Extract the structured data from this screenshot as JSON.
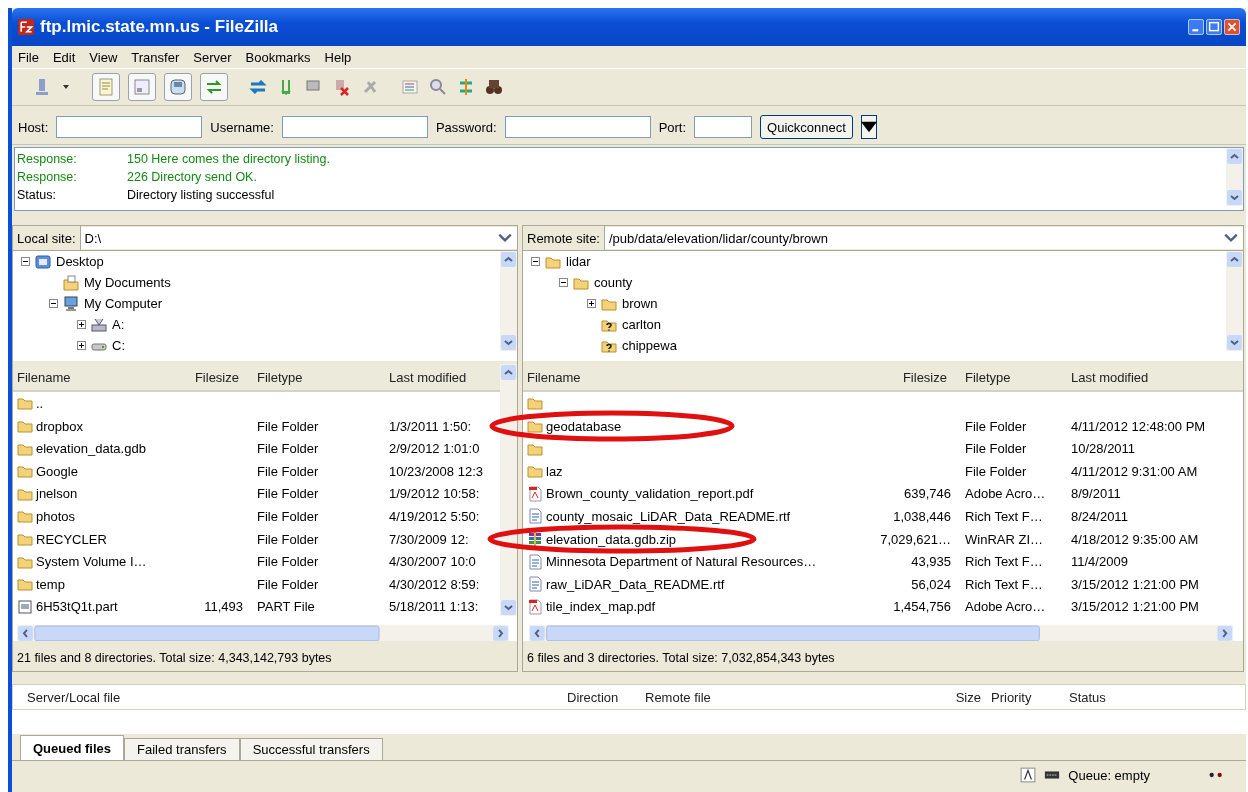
{
  "window": {
    "title": "ftp.lmic.state.mn.us - FileZilla"
  },
  "menu": [
    "File",
    "Edit",
    "View",
    "Transfer",
    "Server",
    "Bookmarks",
    "Help"
  ],
  "quickconnect": {
    "fields": [
      {
        "label": "Host:",
        "kind": "text"
      },
      {
        "label": "Username:",
        "kind": "text"
      },
      {
        "label": "Password:",
        "kind": "password"
      },
      {
        "label": "Port:",
        "kind": "port"
      }
    ],
    "button": "Quickconnect"
  },
  "log": [
    {
      "kind": "response",
      "label": "Response:",
      "message": "150 Here comes the directory listing."
    },
    {
      "kind": "response",
      "label": "Response:",
      "message": "226 Directory send OK."
    },
    {
      "kind": "status",
      "label": "Status:",
      "message": "Directory listing successful"
    }
  ],
  "local": {
    "site_label": "Local site:",
    "path": "D:\\",
    "tree": [
      {
        "name": "Desktop",
        "kind": "desktop",
        "expanded": true,
        "children": [
          {
            "name": "My Documents",
            "kind": "documents"
          },
          {
            "name": "My Computer",
            "kind": "computer",
            "expanded": true,
            "children": [
              {
                "name": "A:",
                "kind": "floppy",
                "expanded": false
              },
              {
                "name": "C:",
                "kind": "drive",
                "expanded": false
              }
            ]
          }
        ]
      }
    ],
    "columns": [
      "Filename",
      "Filesize",
      "Filetype",
      "Last modified"
    ],
    "rows": [
      {
        "kind": "folder",
        "name": ".."
      },
      {
        "kind": "folder",
        "name": "dropbox",
        "type": "File Folder",
        "modified": "1/3/2011 1:50:"
      },
      {
        "kind": "folder",
        "name": "elevation_data.gdb",
        "type": "File Folder",
        "modified": "2/9/2012 1:01:0"
      },
      {
        "kind": "folder",
        "name": "Google",
        "type": "File Folder",
        "modified": "10/23/2008 12:3"
      },
      {
        "kind": "folder",
        "name": "jnelson",
        "type": "File Folder",
        "modified": "1/9/2012 10:58:"
      },
      {
        "kind": "folder",
        "name": "photos",
        "type": "File Folder",
        "modified": "4/19/2012 5:50:"
      },
      {
        "kind": "folder",
        "name": "RECYCLER",
        "type": "File Folder",
        "modified": "7/30/2009 12:"
      },
      {
        "kind": "folder",
        "name": "System Volume I…",
        "type": "File Folder",
        "modified": "4/30/2007 10:0"
      },
      {
        "kind": "folder",
        "name": "temp",
        "type": "File Folder",
        "modified": "4/30/2012 8:59:"
      },
      {
        "kind": "part",
        "name": "6H53tQ1t.part",
        "size": "11,493",
        "type": "PART File",
        "modified": "5/18/2011 1:13:"
      }
    ],
    "summary": "21 files and 8 directories. Total size: 4,343,142,793 bytes"
  },
  "remote": {
    "site_label": "Remote site:",
    "path": "/pub/data/elevation/lidar/county/brown",
    "tree": [
      {
        "name": "lidar",
        "kind": "folder",
        "expanded": true,
        "children": [
          {
            "name": "county",
            "kind": "folder",
            "expanded": true,
            "children": [
              {
                "name": "brown",
                "kind": "folder",
                "expanded": false
              },
              {
                "name": "carlton",
                "kind": "unknown"
              },
              {
                "name": "chippewa",
                "kind": "unknown"
              }
            ]
          }
        ]
      }
    ],
    "columns": [
      "Filename",
      "Filesize",
      "Filetype",
      "Last modified"
    ],
    "rows": [
      {
        "kind": "folder"
      },
      {
        "kind": "folder",
        "name": "geodatabase",
        "type": "File Folder",
        "modified": "4/11/2012 12:48:00 PM"
      },
      {
        "kind": "folder",
        "type": "File Folder",
        "modified": "10/28/2011"
      },
      {
        "kind": "folder",
        "name": "laz",
        "type": "File Folder",
        "modified": "4/11/2012 9:31:00 AM"
      },
      {
        "kind": "pdf",
        "name": "Brown_county_validation_report.pdf",
        "size": "639,746",
        "type": "Adobe Acro…",
        "modified": "8/9/2011"
      },
      {
        "kind": "rtf",
        "name": "county_mosaic_LiDAR_Data_README.rtf",
        "size": "1,038,446",
        "type": "Rich Text F…",
        "modified": "8/24/2011"
      },
      {
        "kind": "zip",
        "name": "elevation_data.gdb.zip",
        "size": "7,029,621…",
        "type": "WinRAR ZI…",
        "modified": "4/18/2012 9:35:00 AM"
      },
      {
        "kind": "rtf",
        "name": "Minnesota Department of Natural Resources…",
        "size": "43,935",
        "type": "Rich Text F…",
        "modified": "11/4/2009"
      },
      {
        "kind": "rtf",
        "name": "raw_LiDAR_Data_README.rtf",
        "size": "56,024",
        "type": "Rich Text F…",
        "modified": "3/15/2012 1:21:00 PM"
      },
      {
        "kind": "pdf",
        "name": "tile_index_map.pdf",
        "size": "1,454,756",
        "type": "Adobe Acro…",
        "modified": "3/15/2012 1:21:00 PM"
      }
    ],
    "summary": "6 files and 3 directories. Total size: 7,032,854,343 bytes"
  },
  "queue": {
    "columns": [
      "Server/Local file",
      "Direction",
      "Remote file",
      "Size",
      "Priority",
      "Status"
    ],
    "tabs": [
      {
        "label": "Queued files",
        "selected": true
      },
      {
        "label": "Failed transfers",
        "selected": false
      },
      {
        "label": "Successful transfers",
        "selected": false
      }
    ]
  },
  "status_bar": {
    "queue": "Queue: empty"
  }
}
